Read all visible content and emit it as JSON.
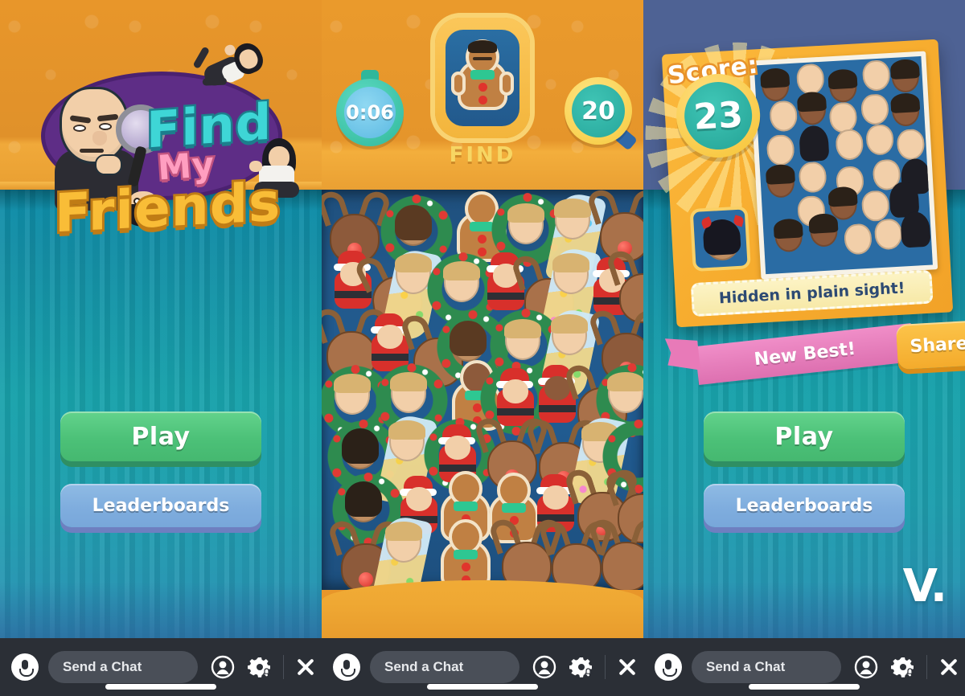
{
  "app": {
    "title": "Find My Friends",
    "watermark": "V."
  },
  "logo": {
    "line1": "Find",
    "line2": "My",
    "line3": "Friends",
    "colors": {
      "find": "#3ed6d6",
      "my": "#ff9ec0",
      "friends": "#f9bd37",
      "oval": "#5e2d86"
    }
  },
  "panels": [
    {
      "id": "left",
      "type": "menu"
    },
    {
      "id": "middle",
      "type": "gameplay"
    },
    {
      "id": "right",
      "type": "results"
    }
  ],
  "menu": {
    "play_label": "Play",
    "leaderboards_label": "Leaderboards",
    "play_color": "#4cc178",
    "leaderboards_color": "#7fadde"
  },
  "game": {
    "timer": "0:06",
    "timer_icon": "stopwatch-icon",
    "find_label": "FIND",
    "target_icon": "gingerbread-avatar-icon",
    "remaining_count": "20",
    "count_icon": "magnifying-glass-icon",
    "board_background": "#22598c"
  },
  "results": {
    "score_label": "Score:",
    "score_value": "23",
    "hint_text": "Hidden in plain sight!",
    "new_best_label": "New Best!",
    "share_label": "Share",
    "target_thumb_icon": "devil-avatar-icon",
    "ribbon_color": "#dd70b0",
    "share_color": "#f4ab2c",
    "score_ring_color": "#f6c231",
    "score_fill_color": "#25a396"
  },
  "chatbar": {
    "segments": [
      {
        "mic_icon": "microphone-icon",
        "input_placeholder": "Send a Chat",
        "friends_icon": "person-circle-icon",
        "settings_icon": "gear-bell-icon",
        "close_icon": "close-icon"
      },
      {
        "mic_icon": "microphone-icon",
        "input_placeholder": "Send a Chat",
        "friends_icon": "person-circle-icon",
        "settings_icon": "gear-bell-icon",
        "close_icon": "close-icon"
      },
      {
        "mic_icon": "microphone-icon",
        "input_placeholder": "Send a Chat",
        "friends_icon": "person-circle-icon",
        "settings_icon": "gear-bell-icon",
        "close_icon": "close-icon"
      }
    ]
  }
}
